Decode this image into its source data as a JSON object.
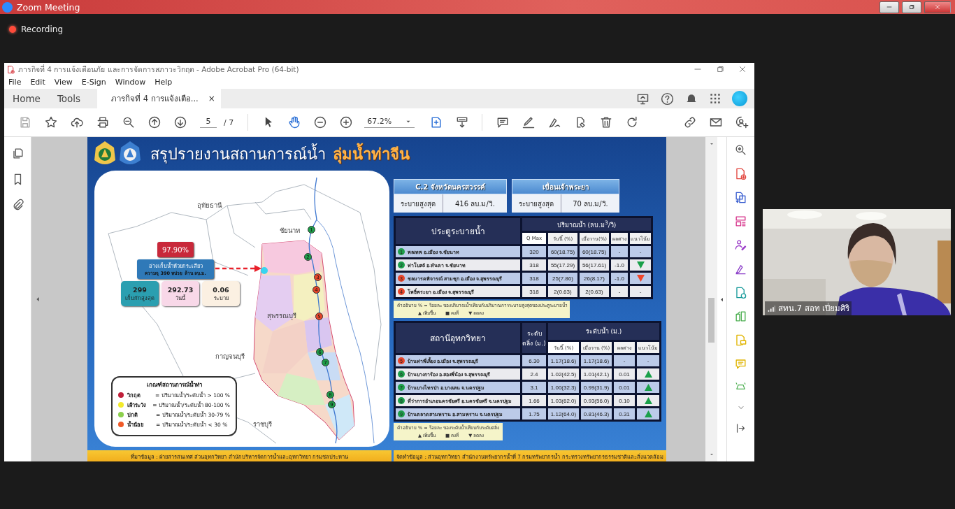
{
  "zoom": {
    "title": "Zoom Meeting",
    "recording": "Recording"
  },
  "acrobat": {
    "title": "ภารกิจที่ 4 การแจ้งเตือนภัย และการจัดการสภาวะวิกฤต - Adobe Acrobat Pro (64-bit)",
    "menu": [
      "File",
      "Edit",
      "View",
      "E-Sign",
      "Window",
      "Help"
    ],
    "tabs": [
      {
        "label": "Home",
        "selected": false
      },
      {
        "label": "Tools",
        "selected": false
      },
      {
        "label": "ภารกิจที่ 4 การแจ้งเตือ...",
        "selected": true,
        "close": "×"
      }
    ],
    "page_current": "5",
    "page_total": "/ 7",
    "zoom_level": "67.2%"
  },
  "slide": {
    "title": "สรุปรายงานสถานการณ์น้ำ",
    "title_highlight": "ลุ่มน้ำท่าจีน",
    "map_labels": [
      "อุทัยธานี",
      "ชัยนาท",
      "สุพรรณบุรี",
      "กาญจนบุรี",
      "ราชบุรี"
    ],
    "markers": [
      {
        "label": "1",
        "color": "#1e9e4a"
      },
      {
        "label": "2",
        "color": "#1e9e4a"
      },
      {
        "label": "3",
        "color": "#e8452a"
      },
      {
        "label": "4",
        "color": "#e8452a"
      },
      {
        "label": "5",
        "color": "#e8452a"
      },
      {
        "label": "6",
        "color": "#1e9e4a"
      },
      {
        "label": "7",
        "color": "#1e9e4a"
      },
      {
        "label": "8",
        "color": "#1e9e4a"
      },
      {
        "label": "9",
        "color": "#1e9e4a"
      }
    ],
    "reservoir": {
      "percent": "97.90%",
      "name": "อ่างเก็บน้ำห้วยกระเสียว",
      "capacity": "ความจุ 390 หน่วย ล้าน ลบ.ม.",
      "stats": [
        {
          "value": "299",
          "label": "เก็บกักสูงสุด",
          "color": "#2b9fb0"
        },
        {
          "value": "292.73",
          "label": "วันนี้",
          "color": "#f8d8e8"
        },
        {
          "value": "0.06",
          "label": "ระบาย",
          "color": "#fbf0e2"
        }
      ]
    },
    "legend": {
      "title": "เกณฑ์สถานการณ์น้ำท่า",
      "items": [
        {
          "label": "วิกฤต",
          "rule": "= ปริมาณน้ำ/ระดับน้ำ > 100 %",
          "color": "#c0203a"
        },
        {
          "label": "เฝ้าระวัง",
          "rule": "= ปริมาณน้ำ/ระดับน้ำ 80-100 %",
          "color": "#f3ea2c"
        },
        {
          "label": "ปกติ",
          "rule": "= ปริมาณน้ำ/ระดับน้ำ 30-79 %",
          "color": "#8ccf4d"
        },
        {
          "label": "น้ำน้อย",
          "rule": "= ปริมาณน้ำ/ระดับน้ำ < 30 %",
          "color": "#f05a28"
        }
      ]
    },
    "discharge_cards": [
      {
        "title": "C.2 จังหวัดนครสวรรค์",
        "label": "ระบายสูงสุด",
        "value": "416 ลบ.ม/วิ."
      },
      {
        "title": "เขื่อนเจ้าพระยา",
        "label": "ระบายสูงสุด",
        "value": "70 ลบ.ม/วิ."
      }
    ],
    "gate_table": {
      "title": "ประตูระบายน้ำ",
      "group": "ปริมาณน้ำ (ลบ.ม$^{3}$/วิ)",
      "columns": [
        "Q Max",
        "วันนี้ (%)",
        "เมื่อวาน(%)",
        "ผลต่าง",
        "แนวโน้ม"
      ],
      "rows": [
        {
          "number": "1",
          "color": "#1e9e4a",
          "name": "พลเทพ อ.เมือง จ.ชัยนาท",
          "cells": [
            "320",
            "60(18.75)",
            "60(18.75)",
            "-"
          ],
          "trend": {
            "kind": "dash",
            "text": "-"
          }
        },
        {
          "number": "2",
          "color": "#1e9e4a",
          "name": "ท่าโบสถ์ อ.หันคา จ.ชัยนาท",
          "cells": [
            "318",
            "55(17.29)",
            "56(17.61)",
            "-1.0"
          ],
          "trend": {
            "kind": "down",
            "color": "#1aa04a"
          }
        },
        {
          "number": "3",
          "color": "#e8452a",
          "name": "ชลมารคพิจารณ์ สามชุก อ.เมือง จ.สุพรรณบุรี",
          "cells": [
            "318",
            "25(7.86)",
            "26(8.17)",
            "-1.0"
          ],
          "trend": {
            "kind": "down",
            "color": "#f0462a"
          }
        },
        {
          "number": "4",
          "color": "#e8452a",
          "name": "โพธิ์พระยา อ.เมือง จ.สุพรรณบุรี",
          "cells": [
            "318",
            "2(0.63)",
            "2(0.63)",
            "-"
          ],
          "trend": {
            "kind": "dash",
            "text": "-"
          }
        }
      ]
    },
    "gate_note": {
      "text": "คำอธิบาย % = ร้อยละ ของปริมาณน้ำเทียบกับปริมาณการระบายสูงสุดของประตูระบายน้ำ",
      "keys": [
        {
          "symbol": "▲",
          "label": "เพิ่มขึ้น"
        },
        {
          "symbol": "■",
          "label": "คงที่"
        },
        {
          "symbol": "▼",
          "label": "ลดลง"
        }
      ]
    },
    "station_table": {
      "title": "สถานีอุทกวิทยา",
      "group": "ระดับน้ำ (ม.)",
      "columns": [
        "ระดับตลิ่ง (ม.)",
        "วันนี้ (%)",
        "เมื่อวาน (%)",
        "ผลต่าง",
        "แนวโน้ม"
      ],
      "rows": [
        {
          "number": "5",
          "color": "#e8452a",
          "name": "บ้านท่าพี่เลี้ยง อ.เมือง จ.สุพรรณบุรี",
          "cells": [
            "6.30",
            "1.17(18.6)",
            "1.17(18.6)",
            "-"
          ],
          "trend": {
            "kind": "dash",
            "text": "-"
          }
        },
        {
          "number": "6",
          "color": "#1e9e4a",
          "name": "บ้านบางการ้อง อ.สองพี่น้อง จ.สุพรรณบุรี",
          "cells": [
            "2.4",
            "1.02(42.5)",
            "1.01(42.1)",
            "0.01"
          ],
          "trend": {
            "kind": "up",
            "color": "#1aa04a"
          }
        },
        {
          "number": "7",
          "color": "#1e9e4a",
          "name": "บ้านบางไทรป่า อ.บางเลน จ.นครปฐม",
          "cells": [
            "3.1",
            "1.00(32.3)",
            "0.99(31.9)",
            "0.01"
          ],
          "trend": {
            "kind": "up",
            "color": "#1aa04a"
          }
        },
        {
          "number": "8",
          "color": "#1e9e4a",
          "name": "ที่ว่าการอำเภอนครชัยศรี อ.นครชัยศรี จ.นครปฐม",
          "cells": [
            "1.66",
            "1.03(62.0)",
            "0.93(56.0)",
            "0.10"
          ],
          "trend": {
            "kind": "up",
            "color": "#1aa04a"
          }
        },
        {
          "number": "9",
          "color": "#1e9e4a",
          "name": "บ้านตลาดสามพราน อ.สามพราน จ.นครปฐม",
          "cells": [
            "1.75",
            "1.12(64.0)",
            "0.81(46.3)",
            "0.31"
          ],
          "trend": {
            "kind": "up",
            "color": "#1aa04a"
          }
        }
      ]
    },
    "station_note": {
      "text": "คำอธิบาย % = ร้อยละ ของระดับน้ำเทียบกับระดับตลิ่ง",
      "keys": [
        {
          "symbol": "▲",
          "label": "เพิ่มขึ้น"
        },
        {
          "symbol": "■",
          "label": "คงที่"
        },
        {
          "symbol": "▼",
          "label": "ลดลง"
        }
      ]
    },
    "footers": [
      "ที่มาข้อมูล : ฝ่ายสารสนเทศ ส่วนอุทกวิทยา สำนักบริหารจัดการน้ำและอุทกวิทยา กรมชลประทาน",
      "จัดทำข้อมูล : ส่วนอุทกวิทยา สำนักงานทรัพยากรน้ำที่ 7 กรมทรัพยากรน้ำ กระทรวงทรัพยากรธรรมชาติและสิ่งแวดล้อม"
    ]
  },
  "video": {
    "name": "สทน.7 สอท เปี่ยมศิริ"
  }
}
